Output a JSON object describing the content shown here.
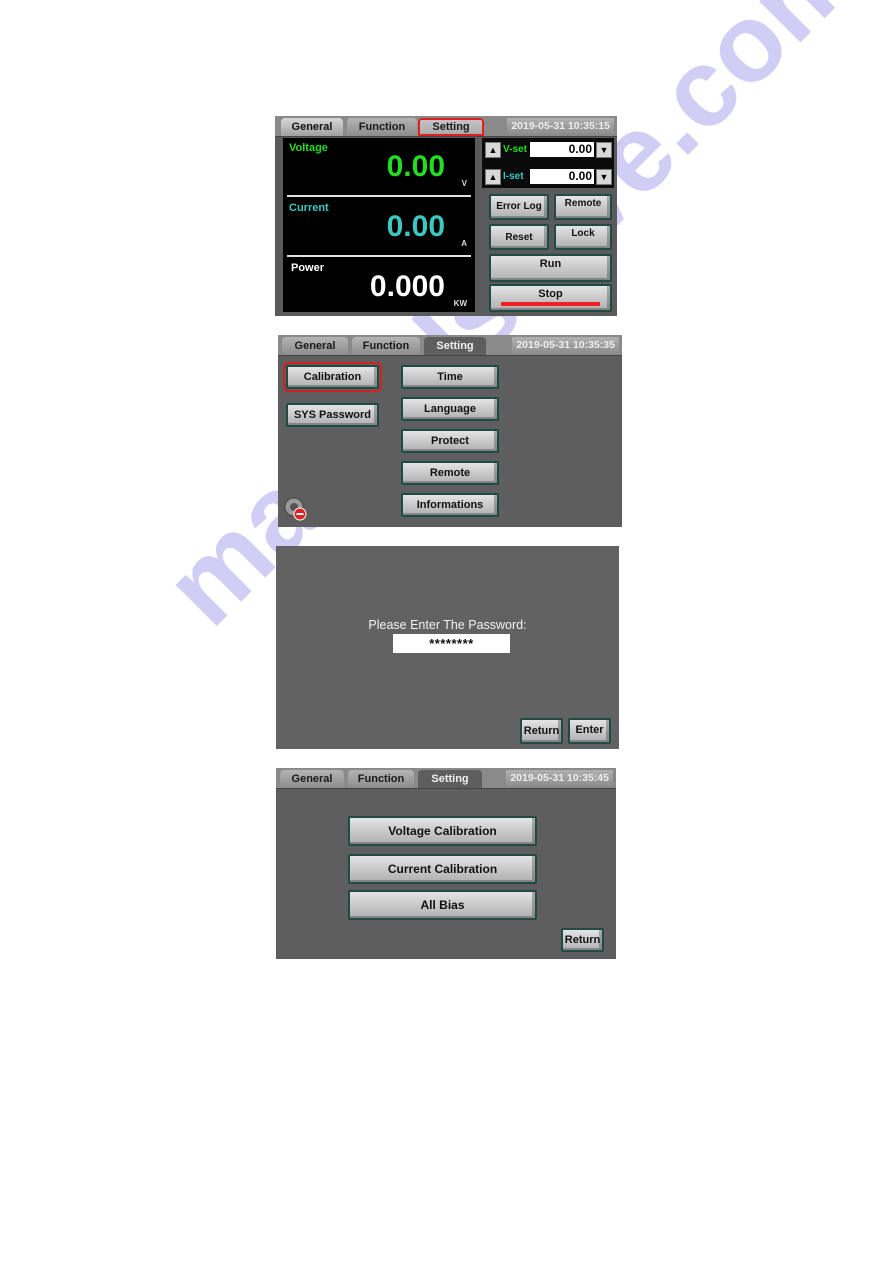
{
  "screens": {
    "general": {
      "tabs": [
        "General",
        "Function",
        "Setting"
      ],
      "active_tab": "General",
      "highlighted_tab": "Setting",
      "datetime": "2019-05-31 10:35:15",
      "voltage": {
        "label": "Voltage",
        "value": "0.00",
        "unit": "V",
        "color": "#22dd22"
      },
      "current": {
        "label": "Current",
        "value": "0.00",
        "unit": "A",
        "color": "#3cc8c0"
      },
      "power": {
        "label": "Power",
        "value": "0.000",
        "unit": "KW",
        "color": "#ffffff"
      },
      "vset": {
        "label": "V-set",
        "value": "0.00",
        "up_icon": "▲",
        "down_icon": "▼"
      },
      "iset": {
        "label": "I-set",
        "value": "0.00",
        "up_icon": "▲",
        "down_icon": "▼"
      },
      "buttons": {
        "error_log": "Error Log",
        "remote": "Remote",
        "reset": "Reset",
        "lock": "Lock",
        "run": "Run",
        "stop": "Stop"
      }
    },
    "setting": {
      "tabs": [
        "General",
        "Function",
        "Setting"
      ],
      "active_tab": "Setting",
      "datetime": "2019-05-31 10:35:35",
      "left_buttons": [
        "Calibration",
        "SYS Password"
      ],
      "highlighted_button": "Calibration",
      "right_buttons": [
        "Time",
        "Language",
        "Protect",
        "Remote",
        "Informations"
      ],
      "status_icon": "locked-gear-icon"
    },
    "password": {
      "prompt": "Please Enter The Password:",
      "value": "********",
      "buttons": {
        "return": "Return",
        "enter": "Enter"
      }
    },
    "calibration": {
      "tabs": [
        "General",
        "Function",
        "Setting"
      ],
      "active_tab": "Setting",
      "datetime": "2019-05-31 10:35:45",
      "buttons": [
        "Voltage Calibration",
        "Current Calibration",
        "All Bias"
      ],
      "return": "Return"
    }
  },
  "watermark": "manualshive.com"
}
